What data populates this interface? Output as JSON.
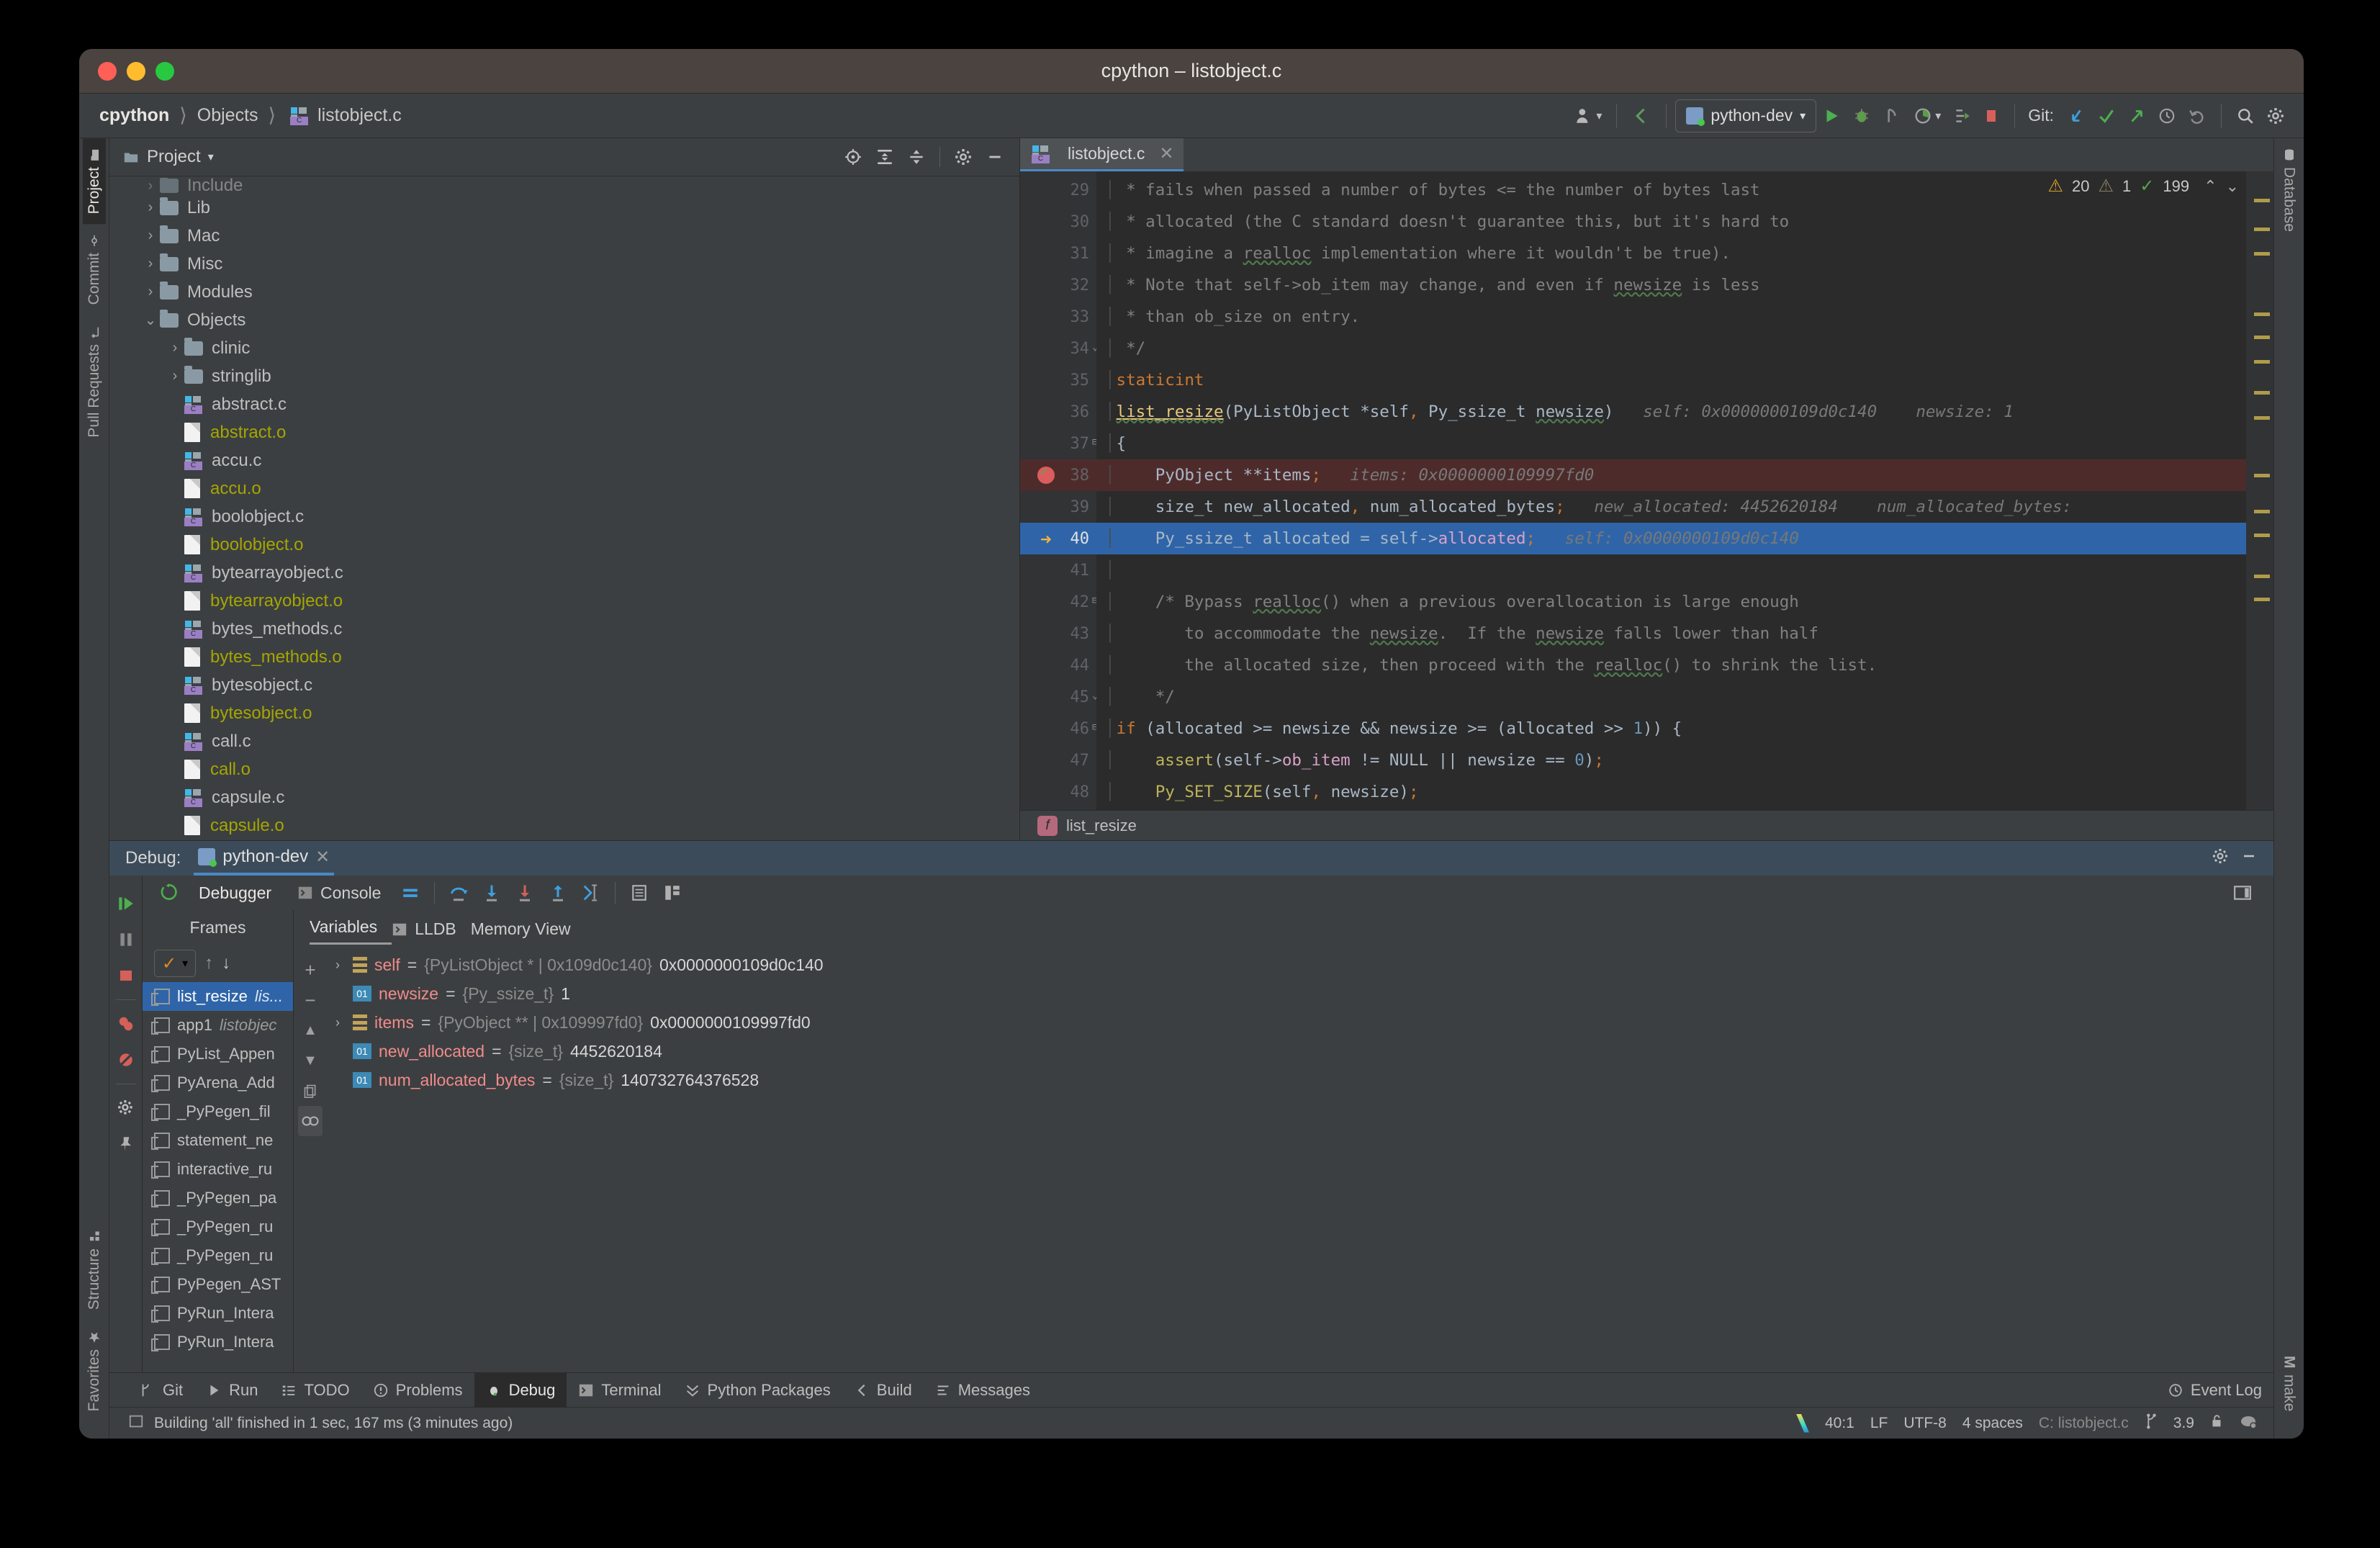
{
  "window": {
    "title": "cpython – listobject.c",
    "traffic": [
      "close",
      "minimize",
      "maximize"
    ]
  },
  "toolbar": {
    "breadcrumb": [
      "cpython",
      "Objects",
      "listobject.c"
    ],
    "run_config": "python-dev",
    "git_label": "Git:",
    "icons": [
      "user-avatar-icon",
      "back-arrow-icon",
      "run-icon",
      "debug-icon",
      "rerun-icon",
      "coverage-icon",
      "profile-icon",
      "stop-icon",
      "git-update-icon",
      "git-commit-icon",
      "git-push-icon",
      "history-icon",
      "rollback-icon",
      "search-everywhere-icon",
      "settings-icon"
    ]
  },
  "left_strip": {
    "tabs": [
      {
        "label": "Project",
        "icon": "folder-icon",
        "active": true
      },
      {
        "label": "Commit",
        "icon": "commit-icon",
        "active": false
      },
      {
        "label": "Pull Requests",
        "icon": "pull-request-icon",
        "active": false
      }
    ],
    "bottom_tabs": [
      {
        "label": "Structure",
        "icon": "structure-icon"
      },
      {
        "label": "Favorites",
        "icon": "star-icon"
      }
    ]
  },
  "right_strip": {
    "tabs": [
      {
        "label": "Database",
        "icon": "database-icon"
      }
    ],
    "bottom_tabs": [
      {
        "label": "make",
        "icon": "m-icon"
      }
    ]
  },
  "project_panel": {
    "title": "Project",
    "header_icons": [
      "locate-icon",
      "expand-all-icon",
      "collapse-all-icon",
      "gear-icon",
      "hide-icon"
    ],
    "tree": [
      {
        "name": "Include",
        "type": "folder",
        "indent": 1,
        "arrow": "right",
        "partial": true
      },
      {
        "name": "Lib",
        "type": "folder",
        "indent": 1,
        "arrow": "right"
      },
      {
        "name": "Mac",
        "type": "folder",
        "indent": 1,
        "arrow": "right"
      },
      {
        "name": "Misc",
        "type": "folder",
        "indent": 1,
        "arrow": "right"
      },
      {
        "name": "Modules",
        "type": "folder",
        "indent": 1,
        "arrow": "right"
      },
      {
        "name": "Objects",
        "type": "folder",
        "indent": 1,
        "arrow": "down"
      },
      {
        "name": "clinic",
        "type": "folder",
        "indent": 2,
        "arrow": "right"
      },
      {
        "name": "stringlib",
        "type": "folder",
        "indent": 2,
        "arrow": "right"
      },
      {
        "name": "abstract.c",
        "type": "cfile",
        "indent": 2
      },
      {
        "name": "abstract.o",
        "type": "ofile",
        "indent": 2
      },
      {
        "name": "accu.c",
        "type": "cfile",
        "indent": 2
      },
      {
        "name": "accu.o",
        "type": "ofile",
        "indent": 2
      },
      {
        "name": "boolobject.c",
        "type": "cfile",
        "indent": 2
      },
      {
        "name": "boolobject.o",
        "type": "ofile",
        "indent": 2
      },
      {
        "name": "bytearrayobject.c",
        "type": "cfile",
        "indent": 2
      },
      {
        "name": "bytearrayobject.o",
        "type": "ofile",
        "indent": 2
      },
      {
        "name": "bytes_methods.c",
        "type": "cfile",
        "indent": 2
      },
      {
        "name": "bytes_methods.o",
        "type": "ofile",
        "indent": 2
      },
      {
        "name": "bytesobject.c",
        "type": "cfile",
        "indent": 2
      },
      {
        "name": "bytesobject.o",
        "type": "ofile",
        "indent": 2
      },
      {
        "name": "call.c",
        "type": "cfile",
        "indent": 2
      },
      {
        "name": "call.o",
        "type": "ofile",
        "indent": 2
      },
      {
        "name": "capsule.c",
        "type": "cfile",
        "indent": 2
      },
      {
        "name": "capsule.o",
        "type": "ofile",
        "indent": 2
      }
    ]
  },
  "editor": {
    "tab": {
      "label": "listobject.c",
      "close": "✕"
    },
    "inspections": {
      "warnings": "20",
      "weak_warnings": "1",
      "passed": "199"
    },
    "breadcrumb_bottom": "list_resize",
    "breadcrumb_badge": "f",
    "lines": [
      {
        "n": "29",
        "state": "normal"
      },
      {
        "n": "30",
        "state": "normal"
      },
      {
        "n": "31",
        "state": "normal"
      },
      {
        "n": "32",
        "state": "normal"
      },
      {
        "n": "33",
        "state": "normal"
      },
      {
        "n": "34",
        "state": "normal",
        "fold": "end"
      },
      {
        "n": "35",
        "state": "normal"
      },
      {
        "n": "36",
        "state": "normal"
      },
      {
        "n": "37",
        "state": "normal",
        "fold": "start"
      },
      {
        "n": "38",
        "state": "breakpoint"
      },
      {
        "n": "39",
        "state": "normal"
      },
      {
        "n": "40",
        "state": "current"
      },
      {
        "n": "41",
        "state": "normal"
      },
      {
        "n": "42",
        "state": "normal",
        "fold": "start"
      },
      {
        "n": "43",
        "state": "normal"
      },
      {
        "n": "44",
        "state": "normal"
      },
      {
        "n": "45",
        "state": "normal",
        "fold": "end"
      },
      {
        "n": "46",
        "state": "normal",
        "fold": "start"
      },
      {
        "n": "47",
        "state": "normal"
      },
      {
        "n": "48",
        "state": "normal"
      }
    ],
    "code_text": [
      " * fails when passed a number of bytes <= the number of bytes last",
      " * allocated (the C standard doesn't guarantee this, but it's hard to",
      " * imagine a realloc implementation where it wouldn't be true).",
      " * Note that self->ob_item may change, and even if newsize is less",
      " * than ob_size on entry.",
      " */",
      "static int",
      "list_resize(PyListObject *self, Py_ssize_t newsize)",
      "{",
      "    PyObject **items;",
      "    size_t new_allocated, num_allocated_bytes;",
      "    Py_ssize_t allocated = self->allocated;",
      "",
      "    /* Bypass realloc() when a previous overallocation is large enough",
      "       to accommodate the newsize.  If the newsize falls lower than half",
      "       the allocated size, then proceed with the realloc() to shrink the list.",
      "    */",
      "    if (allocated >= newsize && newsize >= (allocated >> 1)) {",
      "        assert(self->ob_item != NULL || newsize == 0);",
      "        Py_SET_SIZE(self, newsize);"
    ],
    "inline_hints": {
      "line36_self": "self: 0x0000000109d0c140",
      "line36_newsize": "newsize: 1",
      "line38_items": "items: 0x0000000109997fd0",
      "line39_new_allocated": "new_allocated: 4452620184",
      "line39_num_bytes": "num_allocated_bytes:",
      "line40_self": "self: 0x0000000109d0c140"
    }
  },
  "debug": {
    "header_label": "Debug:",
    "session_tab": "python-dev",
    "session_close": "✕",
    "header_icons": [
      "gear-icon",
      "hide-icon"
    ],
    "toolbar_tabs": [
      {
        "label": "Debugger",
        "icon": "debugger-icon",
        "active": true
      },
      {
        "label": "Console",
        "icon": "console-icon",
        "active": false
      }
    ],
    "toolbar_icons": [
      "layout-icon",
      "step-over-icon",
      "step-into-icon",
      "force-step-into-icon",
      "step-out-icon",
      "run-to-cursor-icon",
      "evaluate-icon",
      "memory-view-icon"
    ],
    "side_icons": [
      "resume-icon",
      "pause-icon",
      "stop-icon",
      "view-breakpoints-icon",
      "mute-breakpoints-icon",
      "settings-icon",
      "pin-icon"
    ],
    "frames": {
      "header": "Frames",
      "thread_selector": "✓",
      "items": [
        {
          "name": "list_resize",
          "file": "lis...",
          "selected": true
        },
        {
          "name": "app1",
          "file": "listobjec",
          "selected": false
        },
        {
          "name": "PyList_Appen",
          "file": "",
          "selected": false
        },
        {
          "name": "PyArena_Add",
          "file": "",
          "selected": false
        },
        {
          "name": "_PyPegen_fil",
          "file": "",
          "selected": false
        },
        {
          "name": "statement_ne",
          "file": "",
          "selected": false
        },
        {
          "name": "interactive_ru",
          "file": "",
          "selected": false
        },
        {
          "name": "_PyPegen_pa",
          "file": "",
          "selected": false
        },
        {
          "name": "_PyPegen_ru",
          "file": "",
          "selected": false
        },
        {
          "name": "_PyPegen_ru",
          "file": "",
          "selected": false
        },
        {
          "name": "PyPegen_AST",
          "file": "",
          "selected": false
        },
        {
          "name": "PyRun_Intera",
          "file": "",
          "selected": false
        },
        {
          "name": "PyRun_Intera",
          "file": "",
          "selected": false
        }
      ]
    },
    "variables": {
      "tabs": [
        {
          "label": "Variables",
          "active": true
        },
        {
          "label": "LLDB",
          "active": false,
          "icon": "lldb-icon"
        },
        {
          "label": "Memory View",
          "active": false
        }
      ],
      "gutter_icons": [
        "add-icon",
        "remove-icon",
        "up-icon",
        "down-icon",
        "copy-icon",
        "watch-icon"
      ],
      "rows": [
        {
          "expandable": true,
          "kind": "object",
          "name": "self",
          "type": "{PyListObject * | 0x109d0c140}",
          "value": "0x0000000109d0c140"
        },
        {
          "expandable": false,
          "kind": "primitive",
          "name": "newsize",
          "type": "{Py_ssize_t}",
          "value": "1"
        },
        {
          "expandable": true,
          "kind": "object",
          "name": "items",
          "type": "{PyObject ** | 0x109997fd0}",
          "value": "0x0000000109997fd0"
        },
        {
          "expandable": false,
          "kind": "primitive",
          "name": "new_allocated",
          "type": "{size_t}",
          "value": "4452620184"
        },
        {
          "expandable": false,
          "kind": "primitive",
          "name": "num_allocated_bytes",
          "type": "{size_t}",
          "value": "140732764376528"
        }
      ]
    }
  },
  "bottom_toolbar": {
    "items": [
      {
        "label": "Git",
        "icon": "git-icon",
        "active": false
      },
      {
        "label": "Run",
        "icon": "run-icon",
        "active": false
      },
      {
        "label": "TODO",
        "icon": "todo-icon",
        "active": false
      },
      {
        "label": "Problems",
        "icon": "problems-icon",
        "active": false
      },
      {
        "label": "Debug",
        "icon": "debug-icon",
        "active": true
      },
      {
        "label": "Terminal",
        "icon": "terminal-icon",
        "active": false
      },
      {
        "label": "Python Packages",
        "icon": "python-packages-icon",
        "active": false
      },
      {
        "label": "Build",
        "icon": "build-icon",
        "active": false
      },
      {
        "label": "Messages",
        "icon": "messages-icon",
        "active": false
      }
    ],
    "event_log": "Event Log"
  },
  "status_bar": {
    "message": "Building 'all' finished in 1 sec, 167 ms (3 minutes ago)",
    "position": "40:1",
    "line_ending": "LF",
    "encoding": "UTF-8",
    "indent": "4 spaces",
    "file_context": "C: listobject.c",
    "branch": "3.9",
    "icons": [
      "vcs-logo-icon",
      "branch-icon",
      "lock-icon",
      "cloud-icon"
    ]
  },
  "colors": {
    "accent": "#4a88c7",
    "current_line": "#2f65a8",
    "breakpoint_line": "#4e2b2b",
    "warning": "#d6a127",
    "ok": "#4fa84f",
    "panel_bg": "#3c3f41",
    "editor_bg": "#2b2b2b"
  }
}
